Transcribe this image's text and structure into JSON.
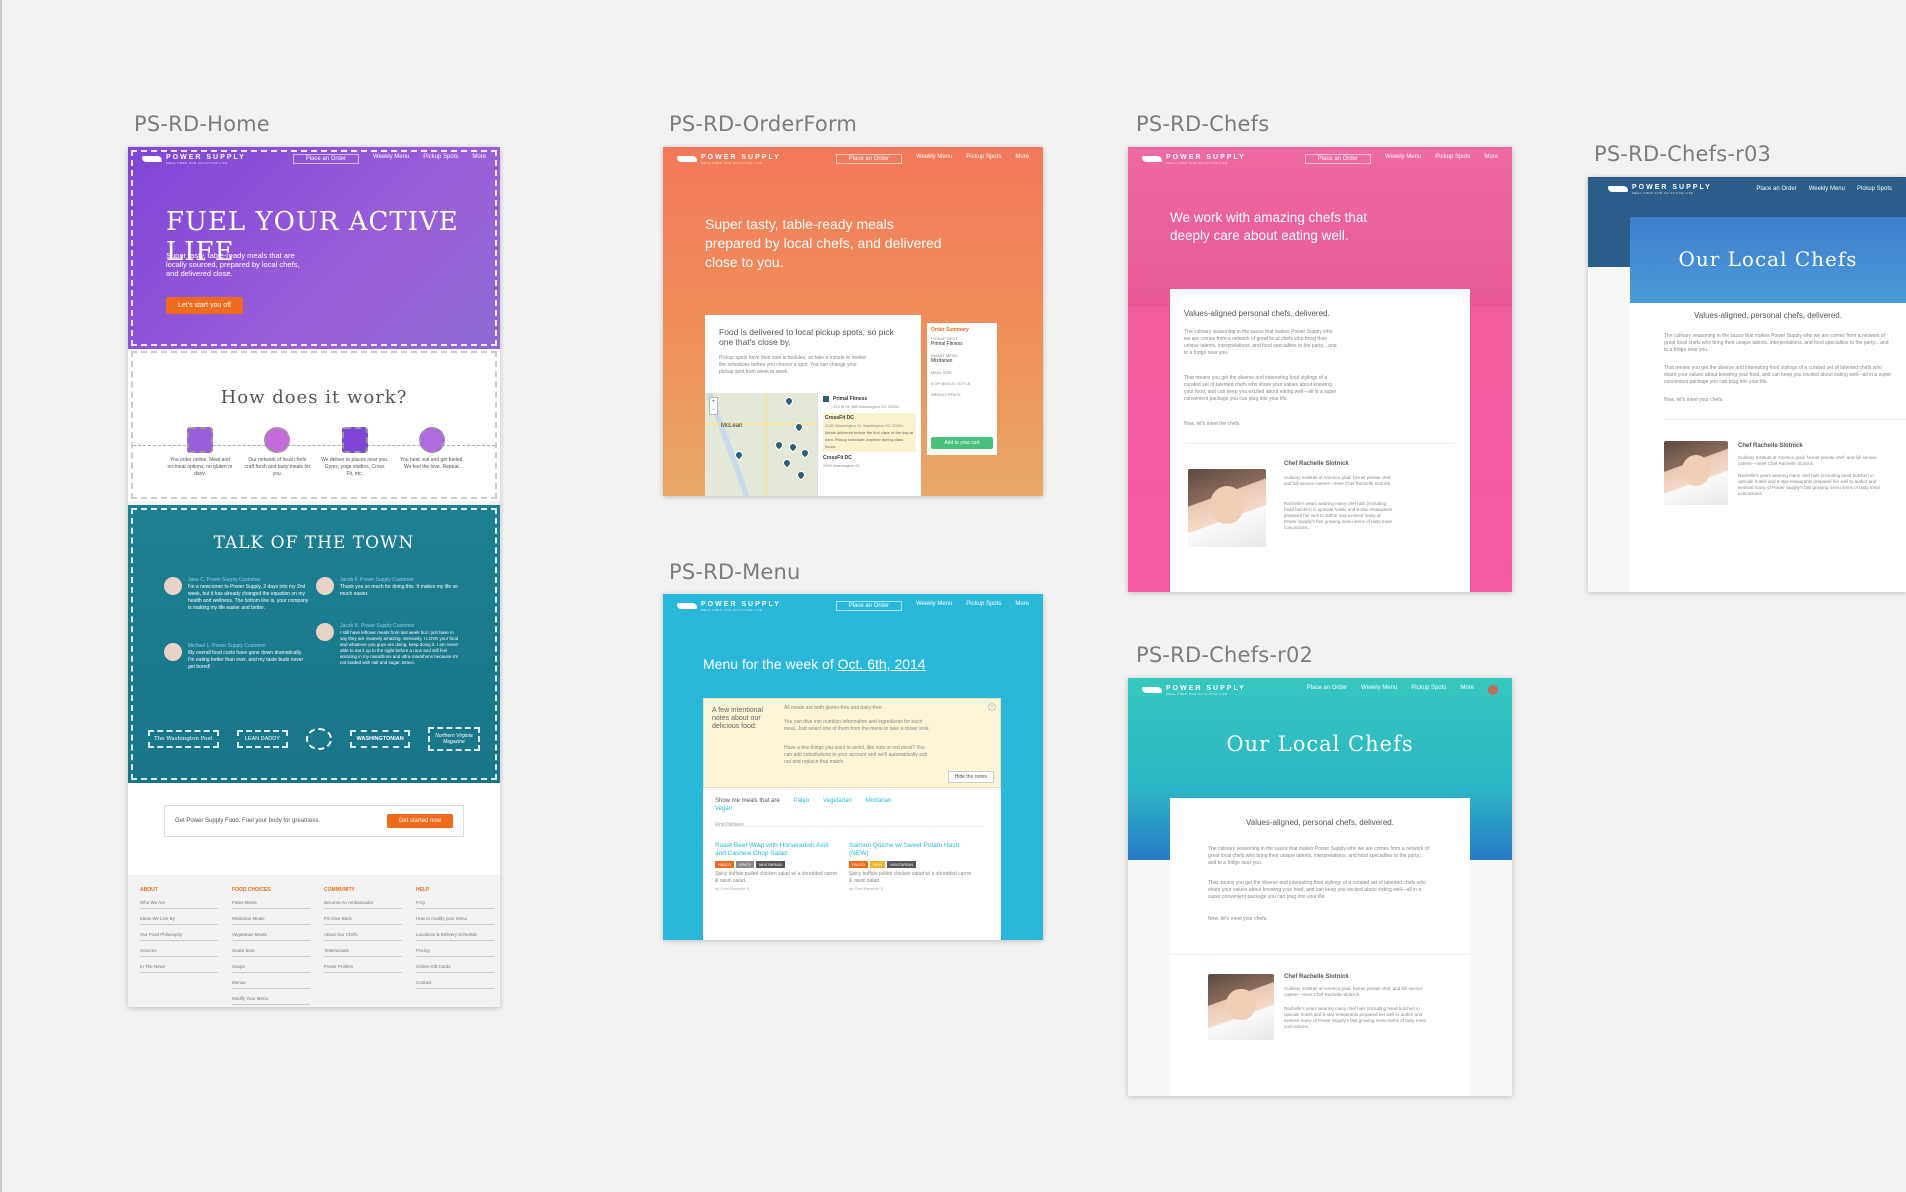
{
  "artboards": {
    "home": "PS-RD-Home",
    "orderform": "PS-RD-OrderForm",
    "chefs": "PS-RD-Chefs",
    "chefs_r03": "PS-RD-Chefs-r03",
    "menu": "PS-RD-Menu",
    "chefs_r02": "PS-RD-Chefs-r02"
  },
  "brand": {
    "name": "POWER SUPPLY",
    "tagline": "MEAL PREP FOR AN ACTIVE LIFE"
  },
  "nav": {
    "place_order": "Place an Order",
    "weekly_menu": "Weekly Menu",
    "pickup_spots": "Pickup Spots",
    "more": "More"
  },
  "home": {
    "hero_title": "FUEL YOUR ACTIVE LIFE",
    "hero_sub": "Super tasty, table-ready meals that are locally sourced, prepared by local chefs, and delivered close.",
    "hero_cta": "Let's start you off",
    "how_title": "How does it work?",
    "steps": [
      "You order online. Meat and no-meat options, no gluten or dairy.",
      "Our network of local chefs craft fresh and tasty meals for you.",
      "We deliver to places near you. Gyms, yoga studios, Cross Fit, etc.",
      "You heat, eat and get fueled. We feel the love. Repeat."
    ],
    "talk_title": "TALK OF THE TOWN",
    "testimonials": [
      {
        "name": "Jane C. Power Supply Customer",
        "text": "I'm a newcomer to Power Supply, 2 days into my 2nd week, but it has already changed the equation on my health and wellness. The bottom line is, your company is making my life easier and better."
      },
      {
        "name": "Jacob F. Power Supply Customer",
        "text": "Thank you so much for doing this. It makes my life so much easier."
      },
      {
        "name": "Michael L. Power Supply Customer",
        "text": "My overall food costs have gone down dramatically. I'm eating better than ever, and my taste buds never get bored!"
      },
      {
        "name": "Jacob K. Power Supply Customer",
        "text": "I still have leftover meals from last week but I just have to say they are insanely amazing. Seriously, I LOVE your food and whatever you guys are doing, keep doing it. I am never able to eat it up to the night before a race and still feel amazing in my marathons and ultra-marathons because it's not loaded with salt and sugar. Bravo."
      }
    ],
    "press": [
      "The Washington Post",
      "LEAN DADDY",
      "WASHINGTONIAN",
      "Northern Virginia Magazine"
    ],
    "get_text": "Get Power Supply Food. Fuel your body for greatness.",
    "get_cta": "Get started now",
    "footer": [
      {
        "heading": "ABOUT",
        "items": [
          "Who We Are",
          "Ideas We Live By",
          "Our Food Philosophy",
          "Sources",
          "In The News"
        ]
      },
      {
        "heading": "FOOD CHOICES",
        "items": [
          "Paleo Meals",
          "Mixitarian Meals",
          "Vegetarian Meals",
          "Snack bars",
          "Soups",
          "Menus",
          "Modify Your Menu"
        ]
      },
      {
        "heading": "COMMUNITY",
        "items": [
          "Become An Ambassador",
          "PS Give Back",
          "About Our Chefs",
          "Testimonials",
          "Power Profiles"
        ]
      },
      {
        "heading": "HELP",
        "items": [
          "FAQ",
          "How to modify your menu",
          "Locations & Delivery Schedule",
          "Pricing",
          "Online Gift Cards",
          "Contact"
        ]
      }
    ]
  },
  "orderform": {
    "hero": "Super tasty, table-ready meals prepared by local chefs, and delivered close to you.",
    "card_title": "Food is delivered to local pickup spots, so pick one that's close by.",
    "card_sub": "Pickup spots have their own schedules, so take a minute to review the schedules before you choose a spot. You can change your pickup spot from week to week.",
    "map_label": "McLean",
    "spots": [
      {
        "name": "Primal Fitness",
        "addr": "213 M St. NW Washington DC 20001"
      },
      {
        "name": "CrossFit DC",
        "addr": "2020 Washington St. Washington DC 20001"
      },
      {
        "name": "CrossFit DC",
        "addr": "2020 Washington St."
      }
    ],
    "spot_note": "Meals delivered before the first class of the day at 6am. Pickup schedule: Anytime during class hours.",
    "summary_title": "Order Summary",
    "summary_rows": [
      {
        "k": "PICKUP SPOT",
        "v": "Primal Fitness"
      },
      {
        "k": "SMART MENU",
        "v": "Mixitarian"
      },
      {
        "k": "MEAL SIZE",
        "v": ""
      },
      {
        "k": "# OF MEALS / STYLE",
        "v": ""
      },
      {
        "k": "WEEKLY PRICE",
        "v": ""
      }
    ],
    "summary_cta": "Add to your cart"
  },
  "chefs": {
    "hero": "We work with amazing chefs that deeply care about eating well.",
    "card_title": "Values-aligned personal chefs, delivered.",
    "p1": "The culinary seasoning in the sauce that makes Power Supply who we are comes from a network of great local chefs who bring their unique talents, interpretations, and food specialties to the party... and to a fridge near you.",
    "p2": "That means you get the diverse and interesting food stylings of a curated set of talented chefs who share your values about knowing your food, and can keep you excited about eating well—all in a super convenient package you can plug into your life.",
    "p3": "Now, let's meet the chefs.",
    "chef_name": "Chef Rachelle Slotnick",
    "chef_bio1": "Culinary Institute of America grad, former private chef, and full service caterer—meet Chef Rachelle Slotnick.",
    "chef_bio2": "Rachelle's years wearing many chef hats (including head butcher) in upscale hotels and 5-star-restaurants prepared her well to author and evolved many of Power Supply's fast growing menu items of tasty meal concoctions."
  },
  "chefs_r03": {
    "hero": "Our Local Chefs",
    "card_title": "Values-aligned, personal chefs, delivered.",
    "p3": "Now, let's meet your chefs."
  },
  "menu": {
    "heading_prefix": "Menu for the week of",
    "heading_date": "Oct. 6th, 2014",
    "notes_title": "A few intentional notes about our delicious food:",
    "note1": "All meals are both gluten-free and dairy-free.",
    "note2": "You can dive into nutrition information and ingredients for each meal. Just select one of them from the menu to take a closer look.",
    "note3": "Have a few things you want to avoid, like nuts or red meat? You can add substitutions to your account and we'll automatically sub out and replace that match.",
    "hide_notes": "Hide the notes",
    "filter_label": "Show me meals that are",
    "filters": [
      "Paleo",
      "Vegetarian",
      "Mixitarian",
      "Vegan"
    ],
    "first_delivery": "First Delivery",
    "meals": [
      {
        "title": "Roast Beef Wrap with Horseradish Aioli and Cashew Chop Salad",
        "tags": [
          "PALEO",
          "SPICY",
          "MIXITARIAN"
        ],
        "desc": "Spicy buffalo pulled chicken salad w/ a shredded carrot & raisin salad.",
        "chef": "by Chef Rachelle S."
      },
      {
        "title": "Salmon Quiche w/ Sweet Potato Hash (NEW)",
        "tags": [
          "PALEO",
          "NEW",
          "MIXITARIAN"
        ],
        "desc": "Spicy buffalo pulled chicken salad w/ a shredded carrot & raisin salad.",
        "chef": "by Chef Rachelle S."
      }
    ]
  },
  "colors": {
    "home_purple": "#8a4fd8",
    "home_teal": "#1e7f93",
    "orange_btn": "#f06a1e",
    "order_orange": "#f2875a",
    "chefs_pink": "#f0529a",
    "menu_blue": "#29b8d9",
    "r02_teal": "#33c4c0",
    "r03_blue": "#3a8fd1"
  }
}
